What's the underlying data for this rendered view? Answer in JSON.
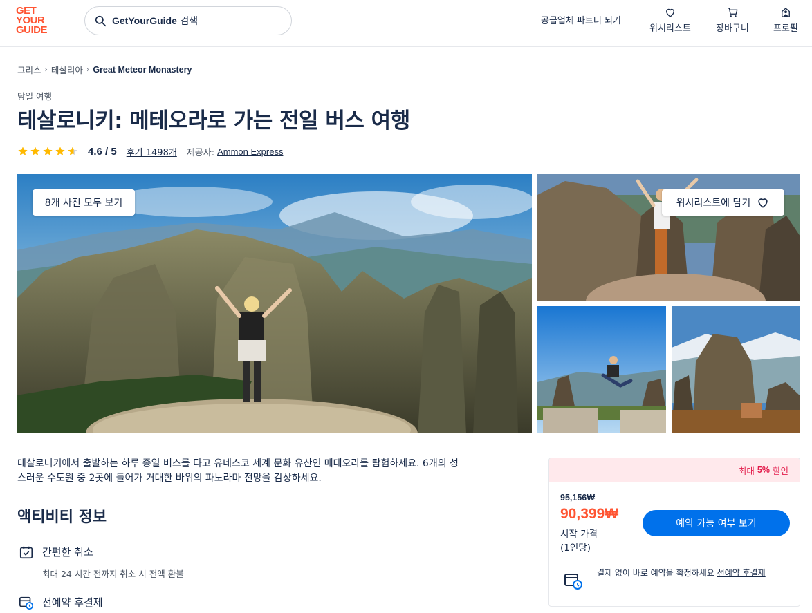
{
  "header": {
    "logo": [
      "GET",
      "YOUR",
      "GUIDE"
    ],
    "search_prefix": "GetYourGuide",
    "search_suffix": "검색",
    "partner": "공급업체 파트너 되기",
    "wishlist": "위시리스트",
    "cart": "장바구니",
    "profile": "프로필"
  },
  "breadcrumb": [
    "그리스",
    "테살리아",
    "Great Meteor Monastery"
  ],
  "activity": {
    "category": "당일 여행",
    "title": "테살로니키: 메테오라로 가는 전일 버스 여행",
    "rating": "4.6 / 5",
    "rating_stars": 4.6,
    "reviews": "후기 1498개",
    "provider_label": "제공자:",
    "provider": "Ammon Express"
  },
  "gallery": {
    "view_all": "8개 사진 모두 보기",
    "wishlist_add": "위시리스트에 담기"
  },
  "description": {
    "line1": "테살로니키에서 출발하는 하루 종일 버스를 타고 유네스코 세계 문화 유산인 메테오라를 탐험하세요. 6개의 성",
    "line2": "스러운 수도원 중 2곳에 들어가 거대한 바위의 파노라마 전망을 감상하세요."
  },
  "info": {
    "title": "액티비티 정보",
    "features": [
      {
        "title": "간편한 취소",
        "sub": "최대 24 시간 전까지 취소 시 전액 환불"
      },
      {
        "title": "선예약 후결제",
        "sub": ""
      }
    ]
  },
  "booking": {
    "discount_prefix": "최대",
    "discount_value": "5%",
    "discount_suffix": "할인",
    "old_price": "95,156₩",
    "new_price": "90,399₩",
    "price_from": "시작 가격",
    "per_person": "(1인당)",
    "cta": "예약 가능 여부 보기",
    "reserve_text": "결제 없이 바로 예약을 확정하세요",
    "reserve_link": "선예약 후결제"
  },
  "colors": {
    "brand": "#ff5533",
    "primary": "#0071eb",
    "text": "#1a2b49",
    "discount": "#e31c4b",
    "star": "#ffb900"
  }
}
